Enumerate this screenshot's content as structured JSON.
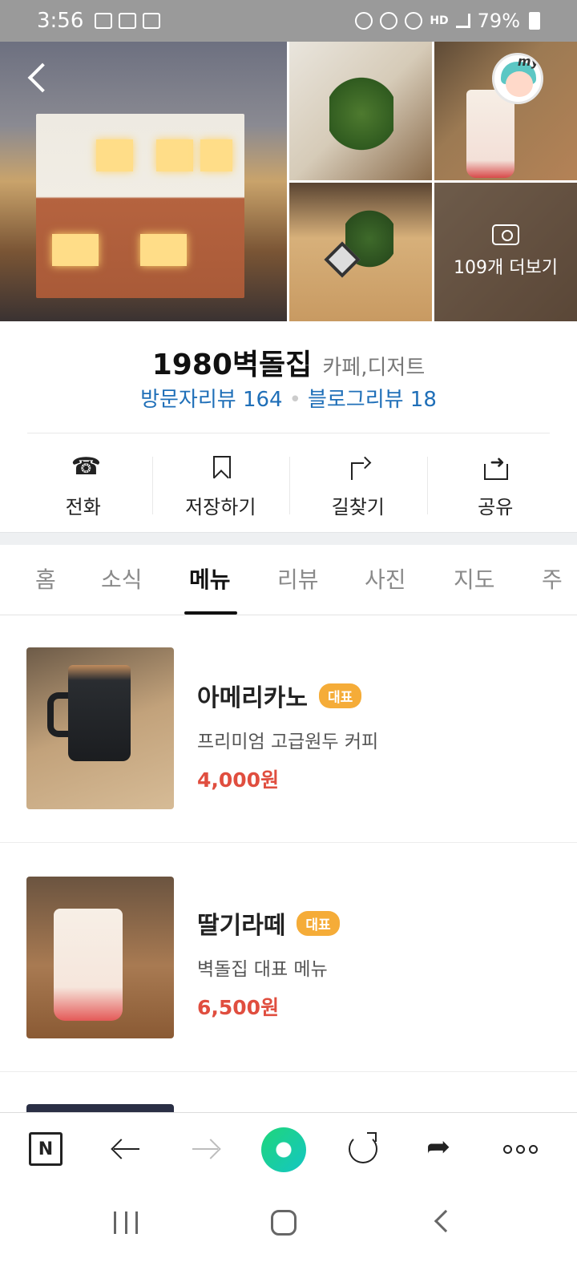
{
  "status_bar": {
    "time": "3:56",
    "battery": "79%",
    "network": "HD"
  },
  "gallery": {
    "more_label": "109개 더보기",
    "avatar_badge": "my"
  },
  "place": {
    "name": "1980벽돌집",
    "category": "카페,디저트",
    "visitor_reviews": "방문자리뷰 164",
    "blog_reviews": "블로그리뷰 18"
  },
  "actions": [
    {
      "label": "전화",
      "icon": "phone-icon"
    },
    {
      "label": "저장하기",
      "icon": "bookmark-icon"
    },
    {
      "label": "길찾기",
      "icon": "directions-icon"
    },
    {
      "label": "공유",
      "icon": "share-icon"
    }
  ],
  "tabs": [
    "홈",
    "소식",
    "메뉴",
    "리뷰",
    "사진",
    "지도",
    "주"
  ],
  "active_tab": "메뉴",
  "menu": [
    {
      "name": "아메리카노",
      "badge": "대표",
      "desc": "프리미엄 고급원두 커피",
      "price": "4,000원"
    },
    {
      "name": "딸기라떼",
      "badge": "대표",
      "desc": "벽돌집 대표 메뉴",
      "price": "6,500원"
    }
  ],
  "browser_bar": {
    "home_letter": "N"
  },
  "colors": {
    "accent_blue": "#1f6fb8",
    "price_red": "#e04e3f",
    "badge_orange": "#f5ac38"
  }
}
